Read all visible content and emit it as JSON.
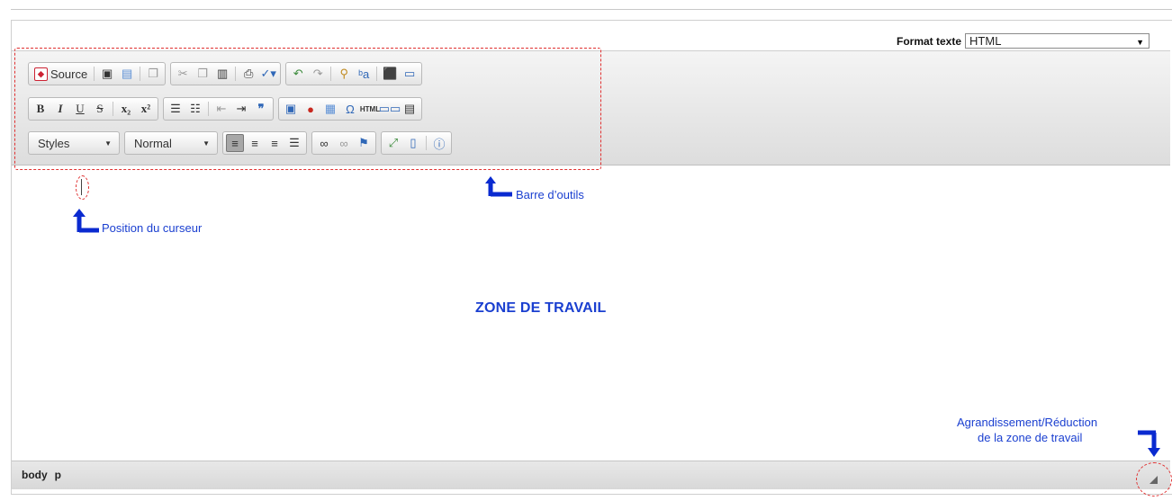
{
  "format": {
    "label": "Format texte",
    "value": "HTML"
  },
  "toolbar": {
    "source_label": "Source",
    "styles_combo": "Styles",
    "format_combo": "Normal"
  },
  "annotations": {
    "toolbar": "Barre d’outils",
    "cursor": "Position du curseur",
    "workzone": "ZONE DE TRAVAIL",
    "resize_line1": "Agrandissement/Réduction",
    "resize_line2": "de la zone de travail"
  },
  "statusbar": {
    "path": [
      "body",
      "p"
    ]
  },
  "icons": {
    "row1": [
      "source-icon",
      "save-icon",
      "preview-icon",
      "templates-icon",
      "cut-icon",
      "copy-icon",
      "paste-icon",
      "print-icon",
      "spellcheck-icon",
      "undo-icon",
      "redo-icon",
      "find-icon",
      "replace-icon",
      "select-all-icon",
      "flash-icon"
    ],
    "row2": [
      "bold-icon",
      "italic-icon",
      "underline-icon",
      "strikethrough-icon",
      "subscript-icon",
      "superscript-icon",
      "numbered-list-icon",
      "bulleted-list-icon",
      "outdent-icon",
      "indent-icon",
      "blockquote-icon",
      "image-icon",
      "flash-object-icon",
      "table-icon",
      "special-char-icon",
      "html-block-icon",
      "book-icon",
      "textbox-icon"
    ],
    "row3": [
      "align-left-icon",
      "align-center-icon",
      "align-right-icon",
      "justify-icon",
      "link-icon",
      "unlink-icon",
      "anchor-icon",
      "maximize-icon",
      "show-blocks-icon",
      "about-icon"
    ]
  },
  "colors": {
    "annotation_blue": "#1a3fd0",
    "dashed_red": "#e03030"
  }
}
